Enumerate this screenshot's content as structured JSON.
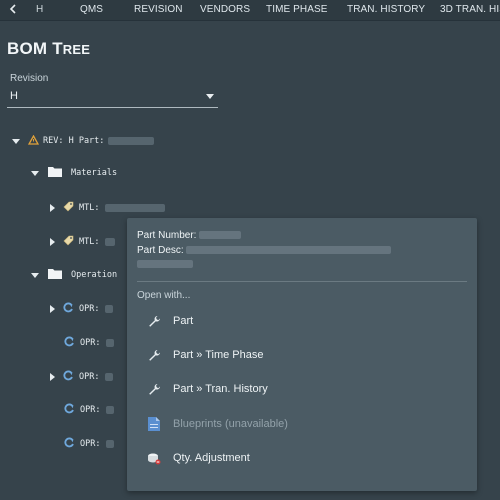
{
  "topbar": {
    "back_label": "H",
    "tabs": [
      "QMS",
      "REVISION",
      "VENDORS",
      "TIME PHASE",
      "TRAN. HISTORY",
      "3D TRAN. HIS"
    ]
  },
  "page": {
    "title_first": "BOM",
    "title_rest_cap": "T",
    "title_rest": "REE"
  },
  "revision": {
    "label": "Revision",
    "value": "H"
  },
  "tree": {
    "root_label": "REV: H Part:",
    "materials_label": "Materials",
    "mtl_prefix": "MTL:",
    "operations_label": "Operation",
    "opr_prefix": "OPR:"
  },
  "menu": {
    "part_number_label": "Part Number:",
    "part_desc_label": "Part Desc:",
    "open_with_label": "Open with...",
    "items": [
      {
        "label": "Part",
        "icon": "wrench-icon",
        "disabled": false
      },
      {
        "label": "Part » Time Phase",
        "icon": "wrench-icon",
        "disabled": false
      },
      {
        "label": "Part » Tran. History",
        "icon": "wrench-icon",
        "disabled": false
      },
      {
        "label": "Blueprints (unavailable)",
        "icon": "blueprint-icon",
        "disabled": true
      },
      {
        "label": "Qty. Adjustment",
        "icon": "qty-adjust-icon",
        "disabled": false
      }
    ]
  },
  "colors": {
    "background": "#36434b",
    "menu_bg": "#4b5b64",
    "warning_icon": "#e2a23a",
    "opr_icon": "#6fa8dc"
  }
}
